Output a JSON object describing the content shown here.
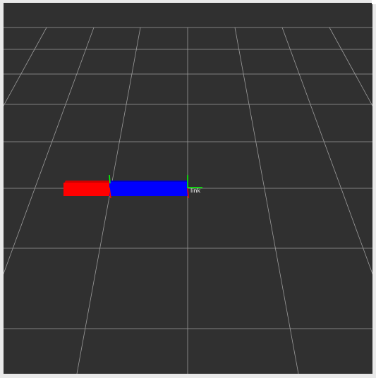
{
  "scene": {
    "background_color": "#303030",
    "grid_color": "#a7a7a7",
    "link_label": "link",
    "colors": {
      "segment_a": "#ff0000",
      "segment_b": "#0000ff",
      "axis_green": "#00ff00",
      "axis_red": "#ff0000",
      "label_text": "#ffffff"
    }
  }
}
